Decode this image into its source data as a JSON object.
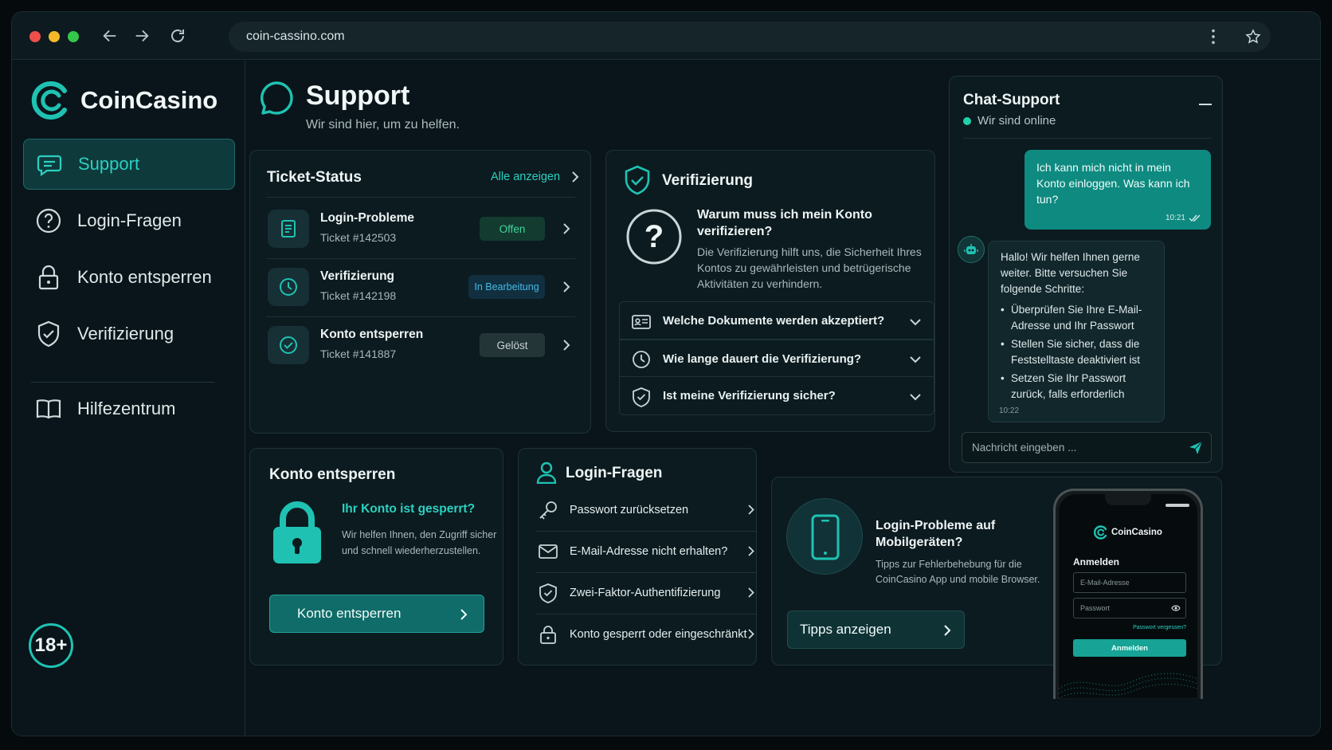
{
  "browser": {
    "url": "coin-cassino.com"
  },
  "brand": {
    "name": "CoinCasino",
    "accent": "#1fc2b2"
  },
  "sidebar": {
    "items": [
      {
        "label": "Support",
        "icon": "chat-icon",
        "active": true
      },
      {
        "label": "Login-Fragen",
        "icon": "question-circle-icon"
      },
      {
        "label": "Konto entsperren",
        "icon": "lock-icon"
      },
      {
        "label": "Verifizierung",
        "icon": "shield-check-icon"
      },
      {
        "label": "Hilfezentrum",
        "icon": "book-icon"
      }
    ],
    "age_badge": "18+"
  },
  "header": {
    "title": "Support",
    "subtitle": "Wir sind hier, um zu helfen."
  },
  "tickets": {
    "title": "Ticket-Status",
    "view_all": "Alle anzeigen",
    "items": [
      {
        "title": "Login-Probleme",
        "number": "Ticket #142503",
        "status": "Offen",
        "icon": "document-icon"
      },
      {
        "title": "Verifizierung",
        "number": "Ticket #142198",
        "status": "In Bearbeitung",
        "icon": "clock-icon"
      },
      {
        "title": "Konto entsperren",
        "number": "Ticket #141887",
        "status": "Gelöst",
        "icon": "check-circle-icon"
      }
    ]
  },
  "verification": {
    "title": "Verifizierung",
    "question": "Warum muss ich mein Konto verifizieren?",
    "answer": "Die Verifizierung hilft uns, die Sicherheit Ihres Kontos zu gewährleisten und betrügerische Aktivitäten zu verhindern.",
    "faqs": [
      {
        "label": "Welche Dokumente werden akzeptiert?",
        "icon": "id-card-icon"
      },
      {
        "label": "Wie lange dauert die Verifizierung?",
        "icon": "clock-icon"
      },
      {
        "label": "Ist meine Verifizierung sicher?",
        "icon": "shield-check-icon"
      }
    ]
  },
  "unlock": {
    "title": "Konto entsperren",
    "heading": "Ihr Konto ist gesperrt?",
    "text": "Wir helfen Ihnen, den Zugriff sicher und schnell wiederherzustellen.",
    "button": "Konto entsperren"
  },
  "login_faq": {
    "title": "Login-Fragen",
    "items": [
      {
        "label": "Passwort zurücksetzen",
        "icon": "key-icon"
      },
      {
        "label": "E-Mail-Adresse nicht erhalten?",
        "icon": "mail-icon"
      },
      {
        "label": "Zwei-Faktor-Authentifizierung",
        "icon": "shield-check-icon"
      },
      {
        "label": "Konto gesperrt oder eingeschränkt",
        "icon": "lock-icon"
      }
    ]
  },
  "mobile": {
    "title": "Login-Probleme auf Mobilgeräten?",
    "text": "Tipps zur Fehlerbehebung für die CoinCasino App und mobile Browser.",
    "button": "Tipps anzeigen",
    "phone": {
      "brand": "CoinCasino",
      "heading": "Anmelden",
      "email_placeholder": "E-Mail-Adresse",
      "password_placeholder": "Passwort",
      "forgot": "Passwort vergessen?",
      "button": "Anmelden"
    }
  },
  "chat": {
    "title": "Chat-Support",
    "status": "Wir sind online",
    "user_message": "Ich kann mich nicht in mein Konto einloggen. Was kann ich tun?",
    "user_time": "10:21",
    "bot_intro": "Hallo! Wir helfen Ihnen gerne weiter. Bitte versuchen Sie folgende Schritte:",
    "bot_steps": [
      "Überprüfen Sie Ihre E-Mail-Adresse und Ihr Passwort",
      "Stellen Sie sicher, dass die Feststelltaste deaktiviert ist",
      "Setzen Sie Ihr Passwort zurück, falls erforderlich"
    ],
    "bot_time": "10:22",
    "input_placeholder": "Nachricht eingeben ..."
  }
}
